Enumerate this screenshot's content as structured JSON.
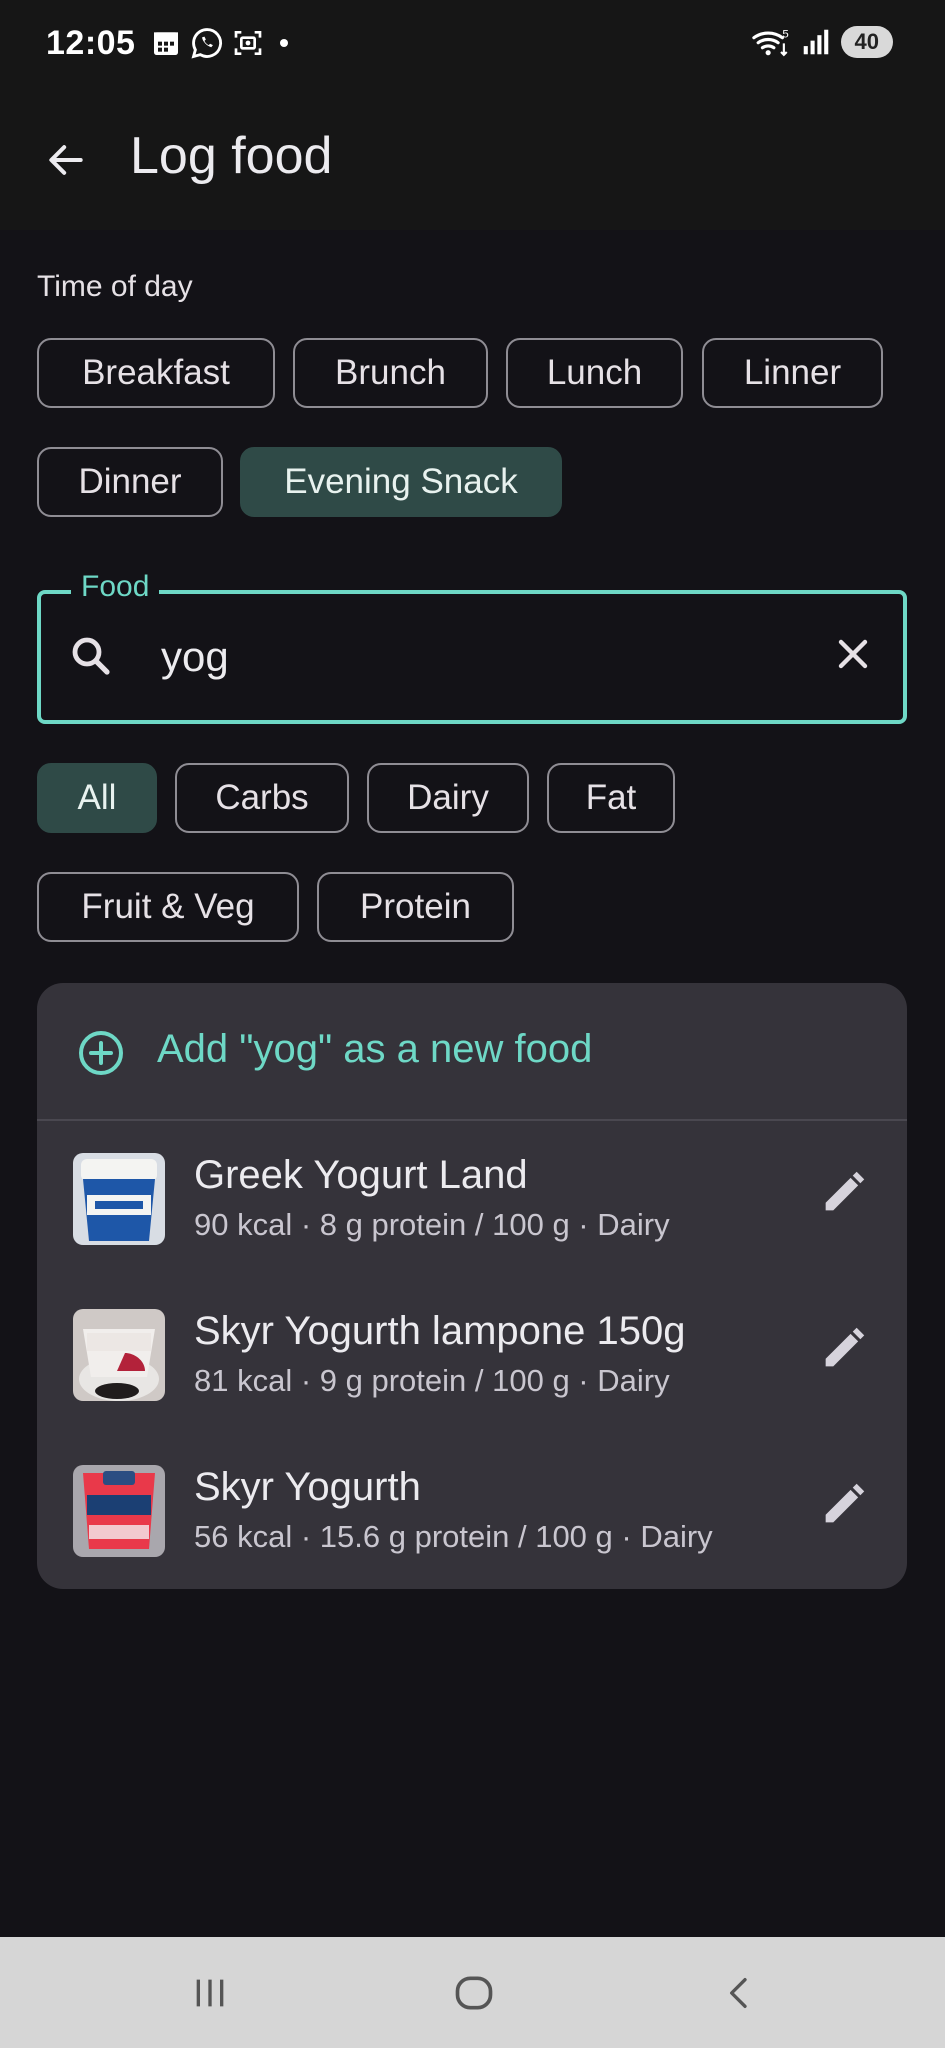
{
  "status_bar": {
    "time": "12:05",
    "battery": "40",
    "icons": [
      "calendar-icon",
      "whatsapp-icon",
      "screenshot-icon",
      "dot-icon",
      "wifi-icon",
      "signal-icon"
    ]
  },
  "header": {
    "title": "Log food",
    "back_icon": "arrow-back-icon"
  },
  "time_of_day": {
    "label": "Time of day",
    "chips": [
      {
        "label": "Breakfast",
        "selected": false
      },
      {
        "label": "Brunch",
        "selected": false
      },
      {
        "label": "Lunch",
        "selected": false
      },
      {
        "label": "Linner",
        "selected": false
      },
      {
        "label": "Dinner",
        "selected": false
      },
      {
        "label": "Evening Snack",
        "selected": true
      }
    ]
  },
  "food_search": {
    "label": "Food",
    "value": "yog"
  },
  "categories": {
    "chips": [
      {
        "label": "All",
        "selected": true
      },
      {
        "label": "Carbs",
        "selected": false
      },
      {
        "label": "Dairy",
        "selected": false
      },
      {
        "label": "Fat",
        "selected": false
      },
      {
        "label": "Fruit & Veg",
        "selected": false
      },
      {
        "label": "Protein",
        "selected": false
      }
    ]
  },
  "results": {
    "add_label": "Add \"yog\" as a new food",
    "items": [
      {
        "name": "Greek Yogurt Land",
        "meta": "90 kcal · 8 g protein / 100 g  ·  Dairy"
      },
      {
        "name": "Skyr Yogurth lampone 150g",
        "meta": "81 kcal · 9 g protein / 100 g  ·  Dairy"
      },
      {
        "name": "Skyr Yogurth",
        "meta": "56 kcal · 15.6 g protein / 100 g  ·  Dairy"
      }
    ]
  },
  "colors": {
    "background": "#131217",
    "accent": "#6ed8c6",
    "chip_selected": "#2f4a47",
    "card": "#35333a"
  }
}
